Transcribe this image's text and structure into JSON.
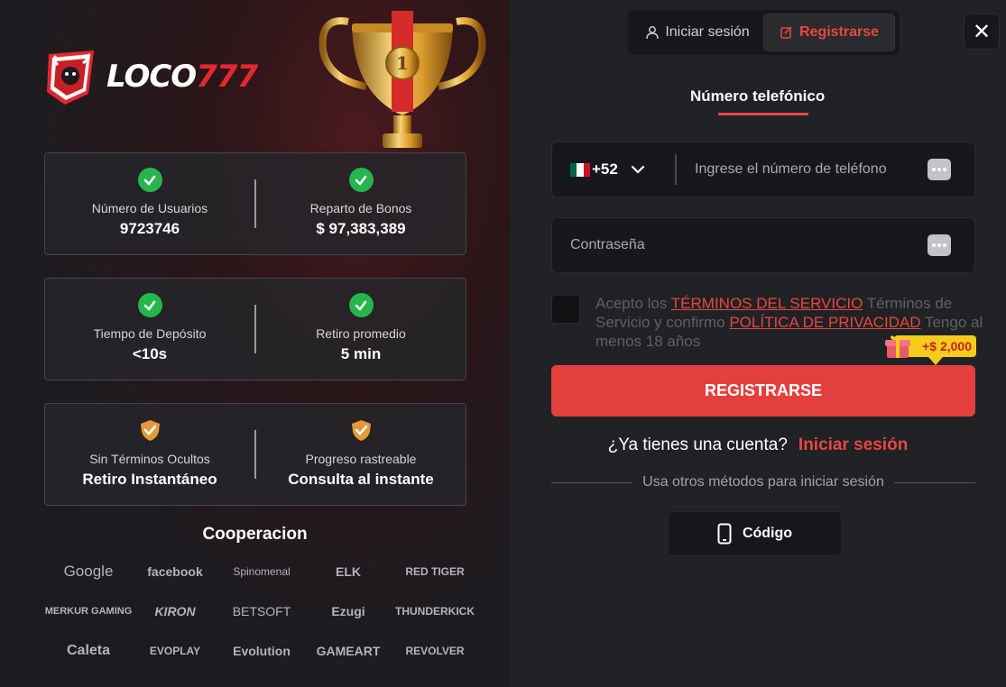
{
  "brand": {
    "logo_white": "LOCO",
    "logo_red": "777",
    "accent": "#e3403d"
  },
  "stats": [
    {
      "left": {
        "icon": "check-icon",
        "label": "Número de Usuarios",
        "value": "9723746"
      },
      "right": {
        "icon": "check-icon",
        "label": "Reparto de Bonos",
        "value": "$ 97,383,389"
      }
    },
    {
      "left": {
        "icon": "check-icon",
        "label": "Tiempo de Depósito",
        "value": "<10s"
      },
      "right": {
        "icon": "check-icon",
        "label": "Retiro promedio",
        "value": "5 min"
      }
    },
    {
      "left": {
        "icon": "shield-icon",
        "label": "Sin Términos Ocultos",
        "value": "Retiro Instantáneo"
      },
      "right": {
        "icon": "shield-icon",
        "label": "Progreso rastreable",
        "value": "Consulta al instante"
      }
    }
  ],
  "cooperation": {
    "title": "Cooperacion",
    "partners": [
      "Google",
      "facebook",
      "Spinomenal",
      "ELK",
      "RED TIGER",
      "MERKUR GAMING",
      "KIRON",
      "BETSOFT",
      "Ezugi",
      "THUNDERKICK",
      "Caleta",
      "EVOPLAY",
      "Evolution",
      "GAMEART",
      "REVOLVER"
    ]
  },
  "tabs": {
    "login": "Iniciar sesión",
    "register": "Registrarse"
  },
  "close": "✕",
  "form": {
    "section_title": "Número telefónico",
    "country_code": "+52",
    "phone_placeholder": "Ingrese el número de teléfono",
    "password_placeholder": "Contraseña",
    "terms_pre": "Acepto los ",
    "terms_link": "TÉRMINOS DEL SERVICIO",
    "terms_mid": " Términos de Servicio y confirmo ",
    "privacy_link": "POLÍTICA DE PRIVACIDAD",
    "terms_post": " Tengo al menos 18 años",
    "bonus": "+$ 2,000",
    "submit": "REGISTRARSE"
  },
  "account": {
    "question": "¿Ya tienes una cuenta?",
    "login_link": "Iniciar sesión"
  },
  "other_methods": {
    "label": "Usa otros métodos para iniciar sesión",
    "code_button": "Código"
  }
}
